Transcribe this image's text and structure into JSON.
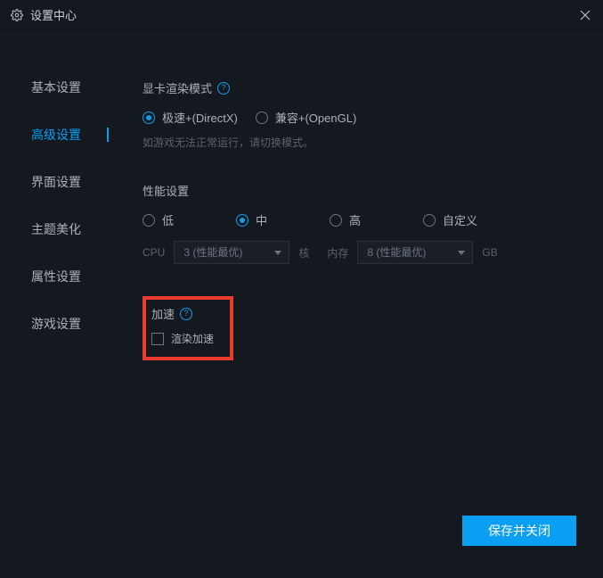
{
  "titlebar": {
    "title": "设置中心"
  },
  "sidebar": {
    "items": [
      {
        "label": "基本设置"
      },
      {
        "label": "高级设置"
      },
      {
        "label": "界面设置"
      },
      {
        "label": "主题美化"
      },
      {
        "label": "属性设置"
      },
      {
        "label": "游戏设置"
      }
    ],
    "active_index": 1
  },
  "render_mode": {
    "title": "显卡渲染模式",
    "options": [
      "极速+(DirectX)",
      "兼容+(OpenGL)"
    ],
    "selected_index": 0,
    "hint": "如游戏无法正常运行，请切换模式。"
  },
  "performance": {
    "title": "性能设置",
    "options": [
      "低",
      "中",
      "高",
      "自定义"
    ],
    "selected_index": 1,
    "cpu_label": "CPU",
    "cpu_value": "3 (性能最优)",
    "cpu_unit": "核",
    "mem_label": "内存",
    "mem_value": "8 (性能最优)",
    "mem_unit": "GB"
  },
  "accel": {
    "title": "加速",
    "checkbox_label": "渲染加速",
    "checked": false
  },
  "footer": {
    "save_label": "保存并关闭"
  }
}
